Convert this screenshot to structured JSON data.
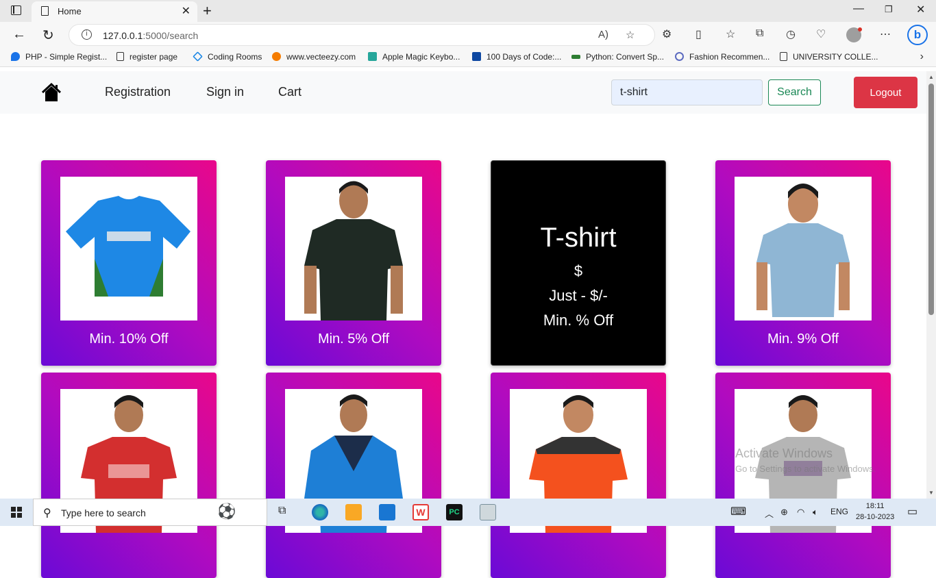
{
  "browser": {
    "tab_title": "Home",
    "url_host": "127.0.0.1",
    "url_path": ":5000/search",
    "bookmarks": [
      {
        "label": "PHP - Simple Regist...",
        "color": "#1a73e8"
      },
      {
        "label": "register page",
        "color": "#ffffff"
      },
      {
        "label": "Coding Rooms",
        "color": "#1e88e5"
      },
      {
        "label": "www.vecteezy.com",
        "color": "#f57c00"
      },
      {
        "label": "Apple Magic Keybo...",
        "color": "#26a69a"
      },
      {
        "label": "100 Days of Code:...",
        "color": "#0d47a1"
      },
      {
        "label": "Python: Convert Sp...",
        "color": "#2e7d32"
      },
      {
        "label": "Fashion Recommen...",
        "color": "#5c6bc0"
      },
      {
        "label": "UNIVERSITY COLLE...",
        "color": "#ffffff"
      }
    ]
  },
  "nav": {
    "links": [
      "Registration",
      "Sign in",
      "Cart"
    ],
    "search_value": "t-shirt",
    "search_button": "Search",
    "logout_button": "Logout"
  },
  "products": [
    {
      "caption": "Min. 10% Off",
      "image": "blue-cricket-jersey"
    },
    {
      "caption": "Min. 5% Off",
      "image": "man-black-polo"
    },
    {
      "type": "detail",
      "title": "T-shirt",
      "price": "$",
      "just": "Just - $/-",
      "offer": "Min. % Off"
    },
    {
      "caption": "Min. 9% Off",
      "image": "man-light-blue-tshirt"
    },
    {
      "caption": "",
      "image": "man-red-tshirt"
    },
    {
      "caption": "",
      "image": "man-blue-jacket"
    },
    {
      "caption": "",
      "image": "man-orange-tshirt"
    },
    {
      "caption": "",
      "image": "man-grey-tshirt"
    }
  ],
  "watermark": {
    "line1": "Activate Windows",
    "line2": "Go to Settings to activate Windows."
  },
  "taskbar": {
    "search_placeholder": "Type here to search",
    "language": "ENG",
    "time": "18:11",
    "date": "28-10-2023"
  }
}
